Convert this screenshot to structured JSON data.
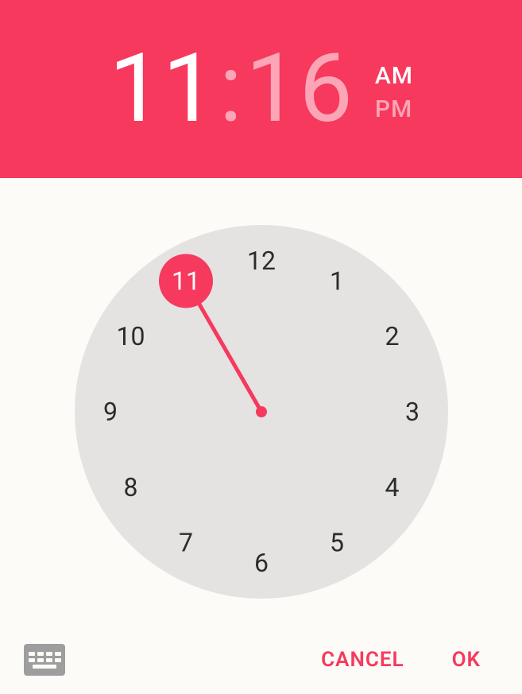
{
  "header": {
    "hours": "11",
    "colon": ":",
    "minutes": "16",
    "am": "AM",
    "pm": "PM",
    "period_selected": "AM",
    "editing": "hours"
  },
  "clock": {
    "numbers": [
      "12",
      "1",
      "2",
      "3",
      "4",
      "5",
      "6",
      "7",
      "8",
      "9",
      "10",
      "11"
    ],
    "selected_hour": 11
  },
  "footer": {
    "cancel": "CANCEL",
    "ok": "OK"
  },
  "colors": {
    "accent": "#f6395d",
    "face": "#e4e3e1",
    "bg": "#fcfbf7"
  }
}
